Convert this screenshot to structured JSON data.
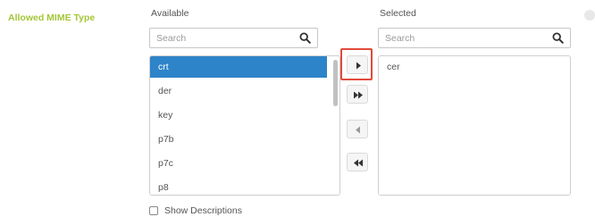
{
  "field": {
    "label": "Allowed MIME Type"
  },
  "available": {
    "title": "Available",
    "search_placeholder": "Search",
    "items": [
      "crt",
      "der",
      "key",
      "p7b",
      "p7c",
      "p8"
    ],
    "selected_item": "crt"
  },
  "selected": {
    "title": "Selected",
    "search_placeholder": "Search",
    "items": [
      "cer"
    ]
  },
  "controls": {
    "move_right": "move-selected-right",
    "move_all_right": "move-all-right",
    "move_left": "move-selected-left",
    "move_all_left": "move-all-left"
  },
  "options": {
    "show_descriptions_label": "Show Descriptions",
    "show_descriptions_checked": false
  },
  "colors": {
    "accent_label": "#a4c639",
    "selection": "#2e84c9",
    "highlight": "#e04b3b"
  }
}
